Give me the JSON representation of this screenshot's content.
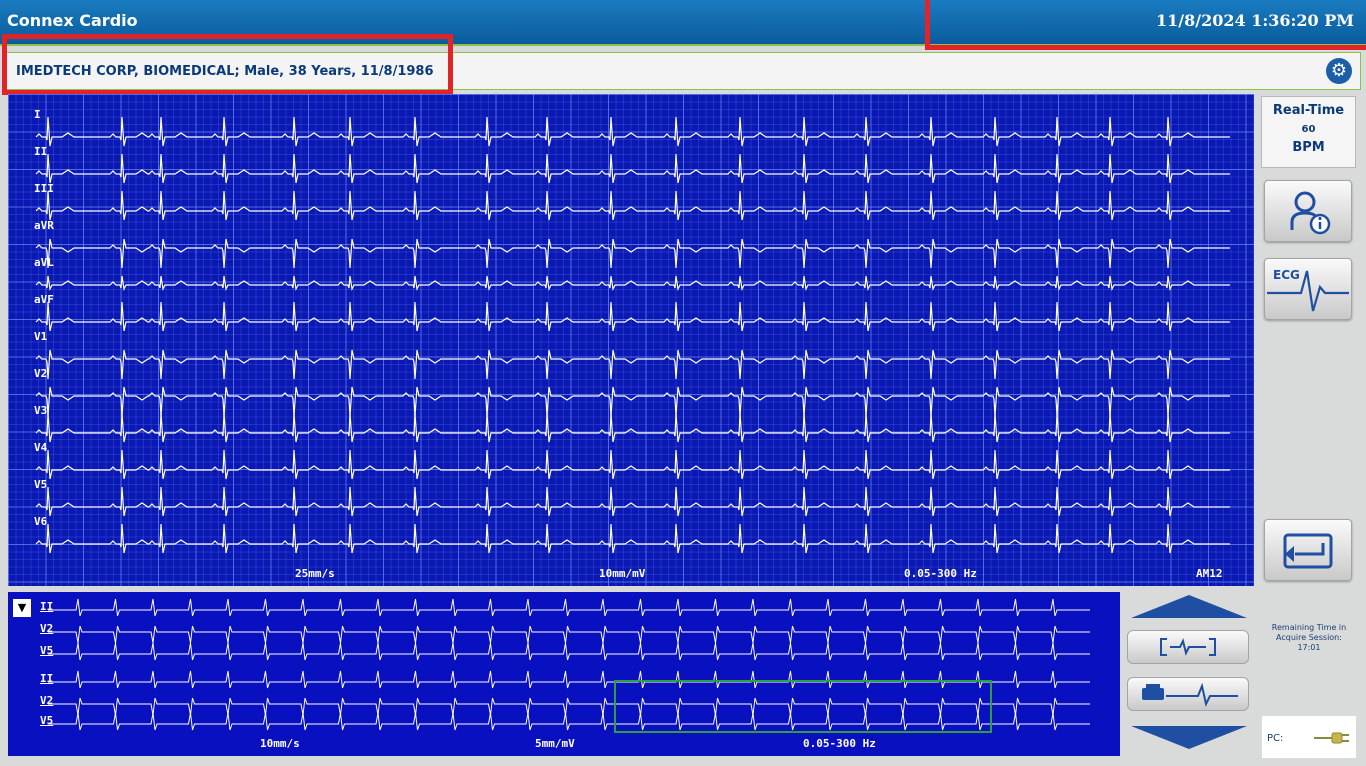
{
  "app": {
    "title": "Connex Cardio",
    "datetime": "11/8/2024 1:36:20 PM"
  },
  "patient": {
    "info": "IMEDTECH CORP, BIOMEDICAL; Male, 38 Years, 11/8/1986",
    "settings_icon": "gear-icon"
  },
  "main_ecg": {
    "leads": [
      "I",
      "II",
      "III",
      "aVR",
      "aVL",
      "aVF",
      "V1",
      "V2",
      "V3",
      "V4",
      "V5",
      "V6"
    ],
    "speed": "25mm/s",
    "gain": "10mm/mV",
    "filter": "0.05-300 Hz",
    "device": "AM12"
  },
  "rhythm": {
    "leads": [
      "II",
      "V2",
      "V5",
      "II",
      "V2",
      "V5"
    ],
    "speed": "10mm/s",
    "gain": "5mm/mV",
    "filter": "0.05-300 Hz"
  },
  "side": {
    "mode": "Real-Time",
    "bpm_value": "60",
    "bpm_unit": "BPM",
    "ecg_button_label": "ECG",
    "patient_info_icon": "patient-info-icon",
    "exit_icon": "return-icon"
  },
  "session": {
    "remaining_label": "Remaining Time in Acquire Session:",
    "remaining_time": "17:01"
  },
  "power": {
    "label": "PC:",
    "icon": "plug-icon"
  },
  "colors": {
    "title_bar": "#0a5c9c",
    "ecg_background": "#0a18b4",
    "accent_green": "#8ac24a",
    "highlight_red": "#e3232a"
  }
}
